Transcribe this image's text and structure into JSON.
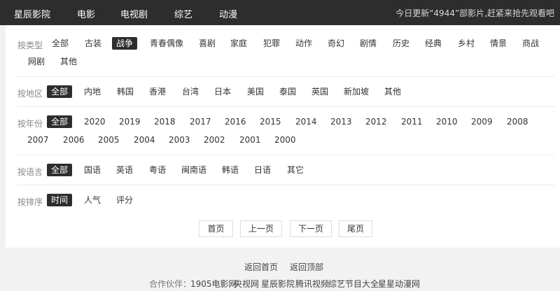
{
  "header": {
    "brand": "星辰影院",
    "nav": [
      "电影",
      "电视剧",
      "综艺",
      "动漫"
    ],
    "update_notice": "今日更新“4944”部影片,赶紧来抢先观看吧"
  },
  "filters": {
    "type": {
      "label": "按类型",
      "selected": "战争",
      "options": [
        "全部",
        "古装",
        "战争",
        "青春偶像",
        "喜剧",
        "家庭",
        "犯罪",
        "动作",
        "奇幻",
        "剧情",
        "历史",
        "经典",
        "乡村",
        "情景",
        "商战",
        "网剧",
        "其他"
      ]
    },
    "region": {
      "label": "按地区",
      "selected": "全部",
      "options": [
        "全部",
        "内地",
        "韩国",
        "香港",
        "台湾",
        "日本",
        "美国",
        "泰国",
        "英国",
        "新加坡",
        "其他"
      ]
    },
    "year": {
      "label": "按年份",
      "selected": "全部",
      "options": [
        "全部",
        "2020",
        "2019",
        "2018",
        "2017",
        "2016",
        "2015",
        "2014",
        "2013",
        "2012",
        "2011",
        "2010",
        "2009",
        "2008",
        "2007",
        "2006",
        "2005",
        "2004",
        "2003",
        "2002",
        "2001",
        "2000"
      ]
    },
    "language": {
      "label": "按语言",
      "selected": "全部",
      "options": [
        "全部",
        "国语",
        "英语",
        "粤语",
        "闽南语",
        "韩语",
        "日语",
        "其它"
      ]
    },
    "sort": {
      "label": "按排序",
      "selected": "时间",
      "options": [
        "时间",
        "人气",
        "评分"
      ]
    }
  },
  "pagination": {
    "first": "首页",
    "prev": "上一页",
    "next": "下一页",
    "last": "尾页"
  },
  "footer": {
    "back_home": "返回首页",
    "back_top": "返回顶部",
    "partners_label": "合作伙伴：",
    "partners": [
      "1905电影网",
      "央视网",
      "星辰影院",
      "腾讯视频",
      "综艺节目大全",
      "星星动漫网"
    ]
  }
}
